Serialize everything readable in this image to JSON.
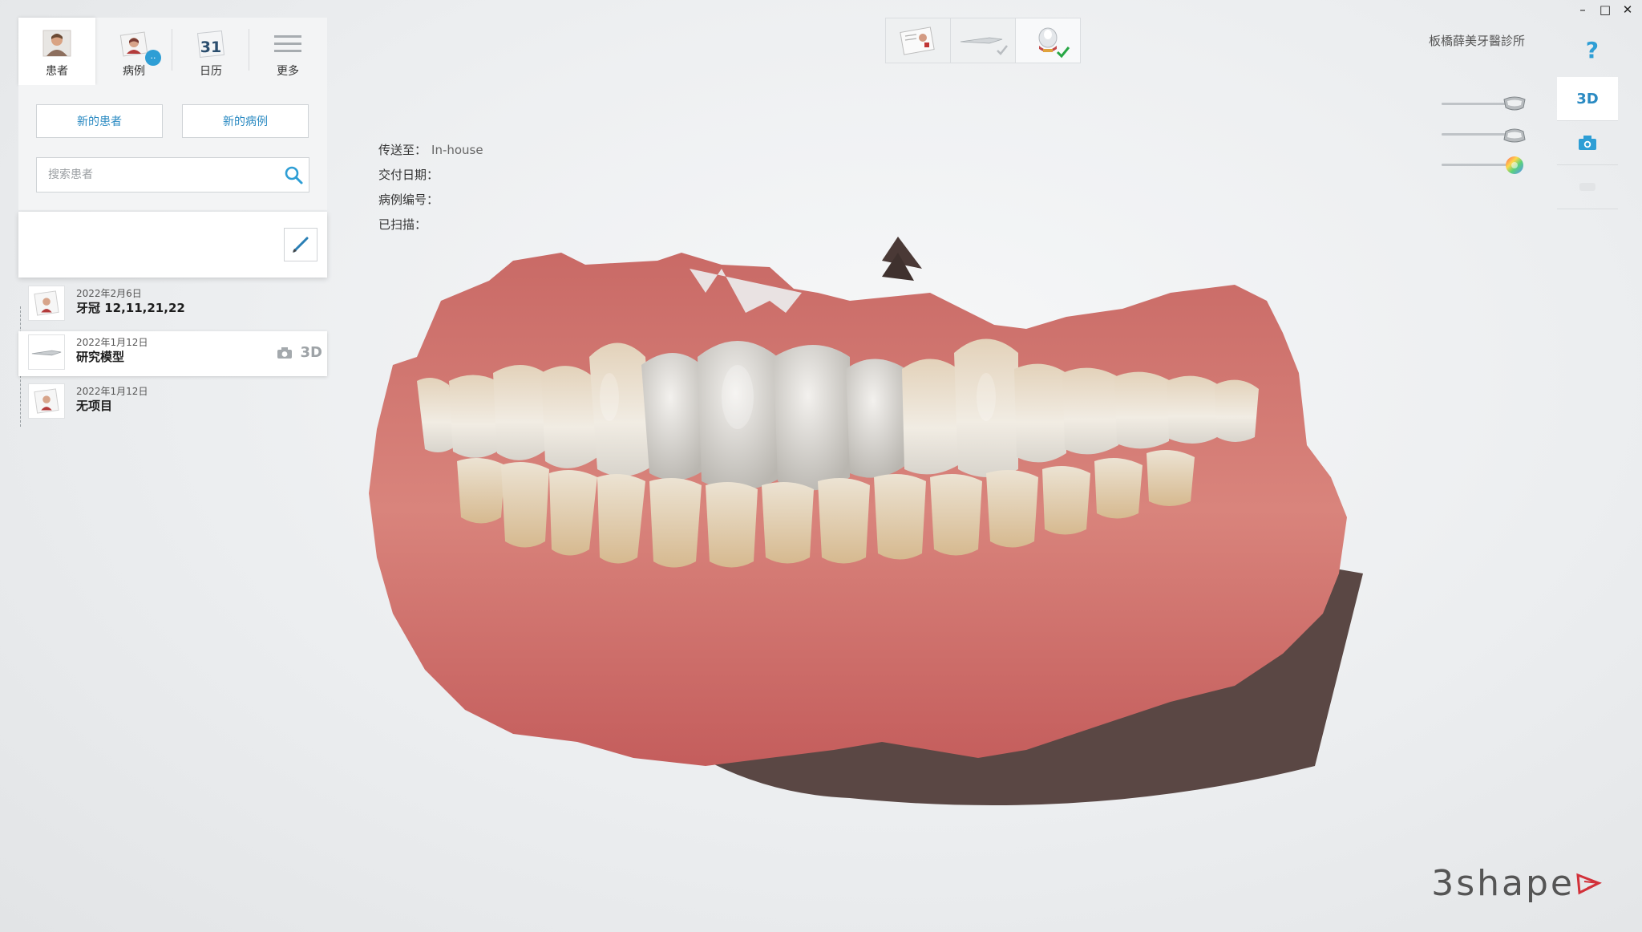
{
  "window": {
    "minimize": "–",
    "maximize": "□",
    "close": "✕"
  },
  "tabs": [
    {
      "label": "患者",
      "icon": "patient-icon",
      "active": true
    },
    {
      "label": "病例",
      "icon": "case-icon",
      "badge": ".."
    },
    {
      "label": "日历",
      "icon": "calendar-icon",
      "day": "31"
    },
    {
      "label": "更多",
      "icon": "menu-icon"
    }
  ],
  "actions": {
    "new_patient": "新的患者",
    "new_case": "新的病例"
  },
  "search": {
    "placeholder": "搜索患者"
  },
  "cases": [
    {
      "date": "2022年2月6日",
      "title": "牙冠 12,11,21,22",
      "icon": "case-thumb-icon"
    },
    {
      "date": "2022年1月12日",
      "title": "研究模型",
      "icon": "scanner-thumb-icon",
      "selected": true,
      "label_3d": "3D"
    },
    {
      "date": "2022年1月12日",
      "title": "无项目",
      "icon": "case-thumb-icon"
    }
  ],
  "info": {
    "send_to_label": "传送至：",
    "send_to_value": "In-house",
    "delivery_label": "交付日期：",
    "case_no_label": "病例编号：",
    "scanned_label": "已扫描："
  },
  "clinic": {
    "name": "板橋薛美牙醫診所"
  },
  "help": {
    "label": "?"
  },
  "view_tools": {
    "label_3d": "3D"
  },
  "sliders": [
    {
      "name": "upper-jaw",
      "level": 0.88
    },
    {
      "name": "lower-jaw",
      "level": 0.88
    },
    {
      "name": "color",
      "level": 0.88
    }
  ],
  "brand": {
    "name": "3shape"
  },
  "colors": {
    "accent": "#2e9ed5",
    "link": "#2a8ac2",
    "brand_red": "#d2313a"
  }
}
